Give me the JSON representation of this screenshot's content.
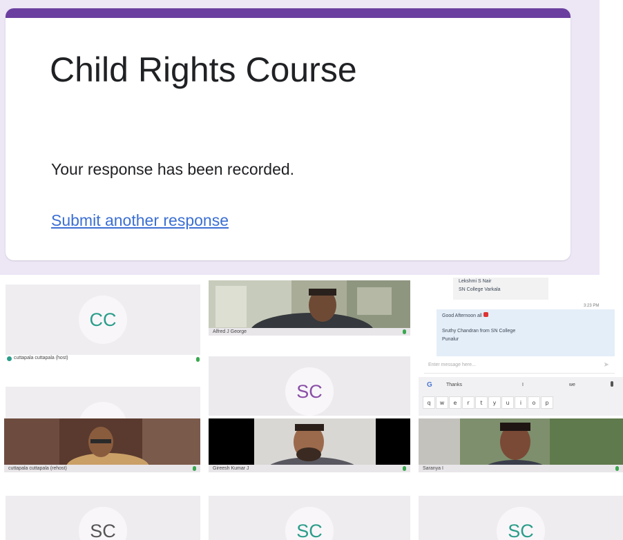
{
  "form": {
    "title": "Child Rights Course",
    "confirmation": "Your response has been recorded.",
    "link": "Submit another response",
    "accent_color": "#6b3fa0"
  },
  "call": {
    "tiles": {
      "cc": {
        "initials": "CC",
        "name": "cuttapala cuttapala (host)"
      },
      "alfred": {
        "name": "Alfred J George"
      },
      "sc_mid": {
        "initials": "SC"
      },
      "host_video": {
        "name": "cuttapala cuttapala (rehost)"
      },
      "gireesh": {
        "name": "Gireesh Kumar J"
      },
      "saranya": {
        "name": "Saranya I"
      },
      "bottom_left": {
        "initials": "SC"
      },
      "bottom_mid": {
        "initials": "SC"
      },
      "bottom_right": {
        "initials": "SC"
      }
    },
    "chat": {
      "msg1_name": "Lekshmi S Nair",
      "msg1_college": "SN College Varkala",
      "time": "3:23 PM",
      "msg2_line1": "Good Afternoon all",
      "msg2_line2": "Sruthy Chandran from SN College",
      "msg2_line3": "Punalur",
      "input_placeholder": "Enter message here...",
      "suggestions": [
        "Thanks",
        "I",
        "we"
      ],
      "keys": [
        "q",
        "w",
        "e",
        "r",
        "t",
        "y",
        "u",
        "i",
        "o",
        "p"
      ]
    }
  }
}
